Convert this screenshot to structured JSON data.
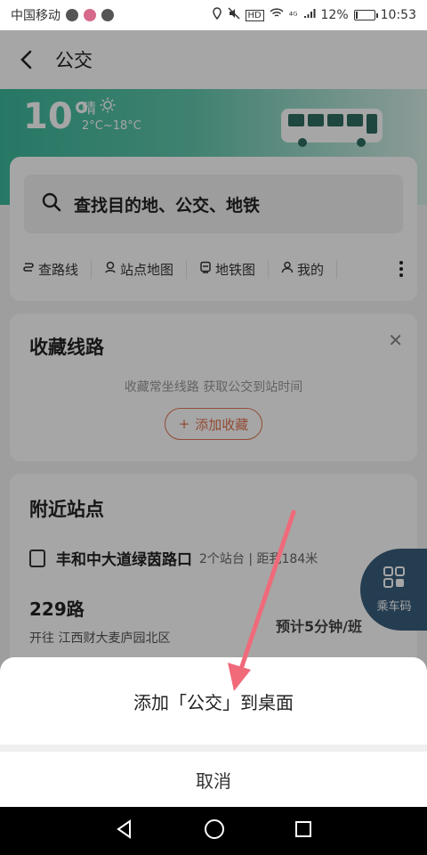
{
  "status_bar": {
    "carrier": "中国移动",
    "signal": "⁴ᴳ",
    "battery": "12%",
    "battery_level": 0.12,
    "time": "10:53"
  },
  "header": {
    "title": "公交"
  },
  "weather": {
    "temperature": "10°",
    "condition": "晴",
    "range": "2°C~18°C"
  },
  "search": {
    "placeholder": "查找目的地、公交、地铁"
  },
  "quick_actions": [
    {
      "label": "查路线",
      "icon": "route-icon"
    },
    {
      "label": "站点地图",
      "icon": "location-pin-icon"
    },
    {
      "label": "地铁图",
      "icon": "subway-icon"
    },
    {
      "label": "我的",
      "icon": "user-icon"
    }
  ],
  "favorites": {
    "title": "收藏线路",
    "subtitle": "收藏常坐线路 获取公交到站时间",
    "add_button": "添加收藏"
  },
  "nearby": {
    "title": "附近站点",
    "station_name": "丰和中大道绿茵路口",
    "station_meta": "2个站台 | 距我184米",
    "route_number": "229路",
    "route_direction": "开往 江西财大麦庐园北区",
    "route_eta": "预计5分钟/班"
  },
  "ride_code": {
    "label": "乘车码"
  },
  "bottom_sheet": {
    "action": "添加「公交」到桌面",
    "cancel": "取消"
  },
  "colors": {
    "accent_green": "#3bb89b",
    "favorite_orange": "#e07450",
    "ride_code_blue": "#3a5f7d",
    "annotation_arrow": "#f06a7a"
  }
}
